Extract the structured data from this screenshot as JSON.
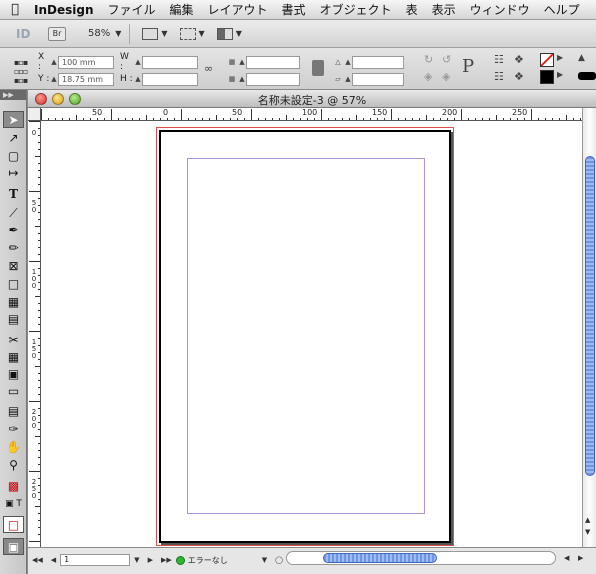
{
  "menubar": {
    "app_name": "InDesign",
    "items": [
      "ファイル",
      "編集",
      "レイアウト",
      "書式",
      "オブジェクト",
      "表",
      "表示",
      "ウィンドウ",
      "ヘルプ"
    ]
  },
  "app_toolbar": {
    "logo_text": "ID",
    "bridge_label": "Br",
    "zoom": "58%"
  },
  "control_panel": {
    "x_label": "X :",
    "x_value": "100 mm",
    "y_label": "Y :",
    "y_value": "18.75 mm",
    "w_label": "W :",
    "w_value": "",
    "h_label": "H :",
    "h_value": "",
    "p_glyph": "P"
  },
  "document": {
    "title": "名称未設定-3 @ 57%",
    "ruler_top": [
      "50",
      "0",
      "50",
      "100",
      "150",
      "200",
      "250"
    ],
    "ruler_left": [
      "0",
      "5\n0",
      "1\n0\n0",
      "1\n5\n0",
      "2\n0\n0",
      "2\n5\n0"
    ]
  },
  "status": {
    "page_number": "1",
    "preflight": "エラーなし"
  },
  "colors": {
    "bleed": "#e24c4c",
    "margin_guide": "#b093d6",
    "preflight_ok": "#2fb533",
    "scroll_thumb": "#6e97e3"
  }
}
